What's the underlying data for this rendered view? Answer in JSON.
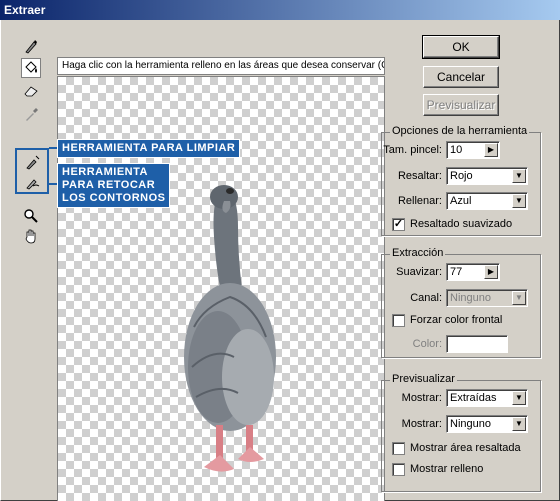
{
  "window": {
    "title": "Extraer"
  },
  "hint": "Haga clic con la herramienta relleno en las áreas que desea conservar (Ct",
  "tools": [
    {
      "name": "edge-highlighter-icon",
      "selected": false
    },
    {
      "name": "fill-bucket-icon",
      "selected": true
    },
    {
      "name": "eraser-icon",
      "selected": false
    },
    {
      "name": "eyedropper-icon",
      "selected": false
    },
    {
      "name": "cleanup-tool-icon",
      "selected": false
    },
    {
      "name": "edge-touchup-tool-icon",
      "selected": false
    },
    {
      "name": "zoom-icon",
      "selected": false
    },
    {
      "name": "hand-icon",
      "selected": false
    }
  ],
  "callouts": {
    "cleanup": "HERRAMIENTA PARA LIMPIAR",
    "touchup_line1": "HERRAMIENTA",
    "touchup_line2": "PARA RETOCAR",
    "touchup_line3": "LOS CONTORNOS"
  },
  "buttons": {
    "ok": "OK",
    "cancel": "Cancelar",
    "preview": "Previsualizar"
  },
  "tool_options": {
    "title": "Opciones de la herramienta",
    "brush_size_label": "Tam. pincel:",
    "brush_size_value": "10",
    "highlight_label": "Resaltar:",
    "highlight_value": "Rojo",
    "fill_label": "Rellenar:",
    "fill_value": "Azul",
    "smart_highlight_label": "Resaltado suavizado",
    "smart_highlight_checked": true
  },
  "extraction": {
    "title": "Extracción",
    "smooth_label": "Suavizar:",
    "smooth_value": "77",
    "channel_label": "Canal:",
    "channel_value": "Ninguno",
    "force_fg_label": "Forzar color frontal",
    "force_fg_checked": false,
    "color_label": "Color:"
  },
  "preview": {
    "title": "Previsualizar",
    "show_label": "Mostrar:",
    "show_value": "Extraídas",
    "show2_label": "Mostrar:",
    "show2_value": "Ninguno",
    "show_highlight_label": "Mostrar área resaltada",
    "show_highlight_checked": false,
    "show_fill_label": "Mostrar relleno",
    "show_fill_checked": false
  },
  "colors": {
    "accent": "#1e5fa8",
    "titlebar": "#0a246a",
    "dialog": "#d4d0c8"
  }
}
